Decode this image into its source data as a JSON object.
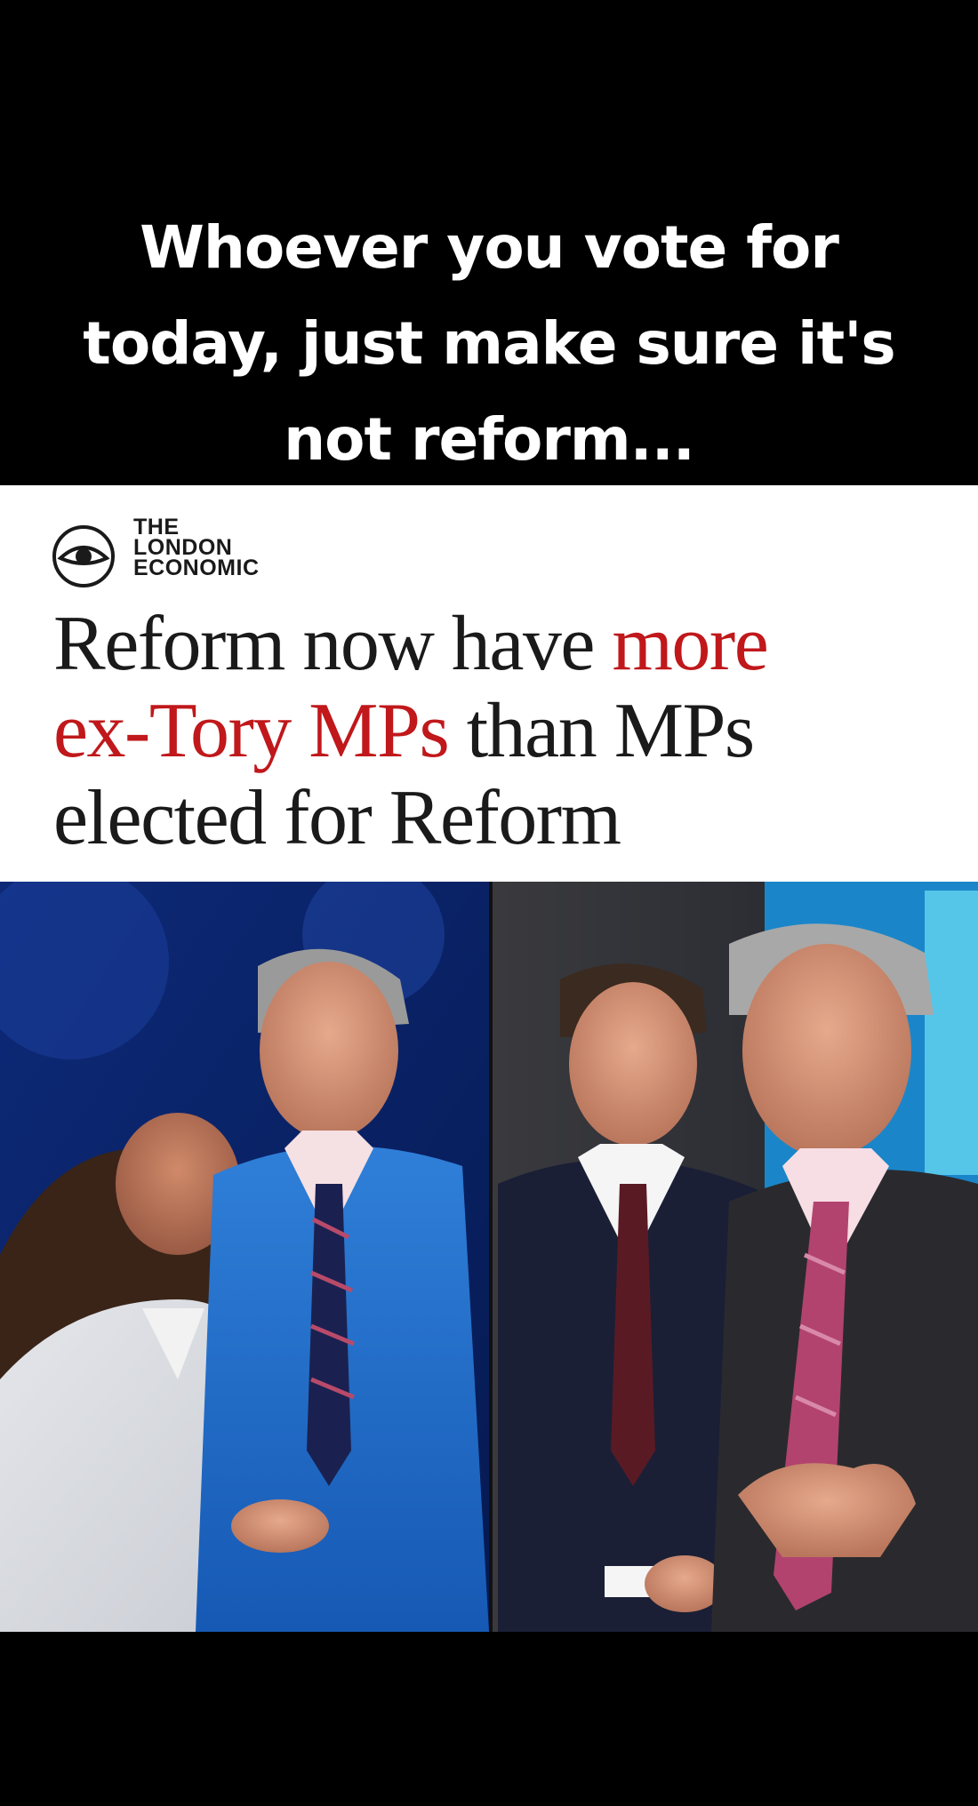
{
  "caption": {
    "line1": "Whoever you vote for",
    "line2": "today, just make sure it's",
    "line3": "not reform..."
  },
  "logo": {
    "icon": "eye-icon",
    "line1": "THE",
    "line2": "LONDON",
    "line3": "ECONOMIC"
  },
  "headline": {
    "part1": "Reform now have ",
    "part2_red": "more",
    "part3_red": "ex-Tory MPs",
    "part4": " than MPs",
    "part5": "elected for Reform"
  },
  "colors": {
    "headline_red": "#c0181b",
    "background": "#000000",
    "card": "#ffffff"
  }
}
